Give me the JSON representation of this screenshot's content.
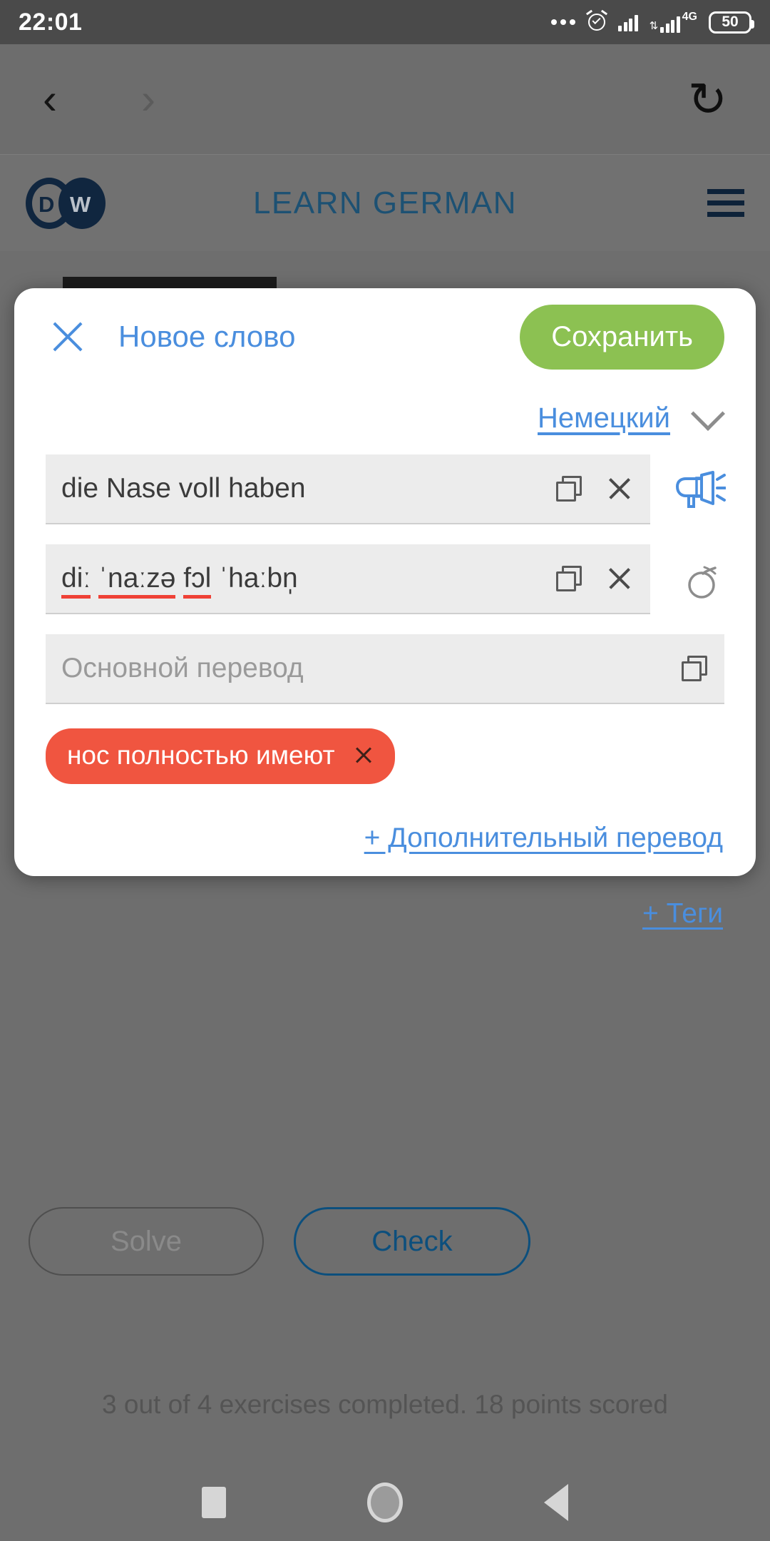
{
  "status_bar": {
    "time": "22:01",
    "battery_level": "50",
    "network_type": "4G",
    "icons": [
      "more-dots-icon",
      "alarm-clock-icon",
      "signal-bars-icon",
      "mobile-data-icon",
      "battery-icon"
    ]
  },
  "browser": {
    "back_icon": "‹",
    "forward_icon": "›",
    "reload_icon": "↻"
  },
  "page_header": {
    "logo_d": "D",
    "logo_w": "W",
    "title": "LEARN GERMAN",
    "menu_icon": "hamburger-menu-icon"
  },
  "modal": {
    "title": "Новое слово",
    "close_label": "close-icon",
    "save_label": "Сохранить",
    "language_selected": "Немецкий",
    "fields": [
      {
        "name": "word",
        "value": "die Nase voll haben",
        "placeholder": "",
        "has_copy": true,
        "has_clear": true,
        "side_icon": "speaker-megaphone-icon"
      },
      {
        "name": "transcription",
        "value_parts": [
          {
            "text": "diː",
            "error": true
          },
          {
            "text": " ",
            "error": false
          },
          {
            "text": "ˈnaːzə",
            "error": true
          },
          {
            "text": " ",
            "error": false
          },
          {
            "text": "fɔl",
            "error": true
          },
          {
            "text": " ˈhaːbn̩",
            "error": false
          }
        ],
        "plain": "diː ˈnaːzə fɔl ˈhaːbn̩",
        "has_copy": true,
        "has_clear": true,
        "side_icon": "phonetic-breve-icon"
      },
      {
        "name": "main-translation",
        "value": "",
        "placeholder": "Основной перевод",
        "has_copy": true,
        "has_clear": false,
        "side_icon": ""
      }
    ],
    "tag": {
      "label": "нос полностью имеют",
      "remove_icon": "remove-tag-icon"
    },
    "add_translation_label": "+ Дополнительный перевод",
    "add_tags_label": "+ Теги"
  },
  "exercise": {
    "solve_label": "Solve",
    "check_label": "Check",
    "progress_text": "3 out of 4 exercises completed. 18 points scored"
  },
  "android_nav": {
    "recent_icon": "recents-square-icon",
    "home_icon": "home-circle-icon",
    "back_icon": "back-triangle-icon"
  },
  "colors": {
    "accent_blue": "#4a8ede",
    "brand_navy": "#1d5173",
    "save_green": "#8cc152",
    "tag_red": "#f05540",
    "error_red": "#ef4136"
  }
}
